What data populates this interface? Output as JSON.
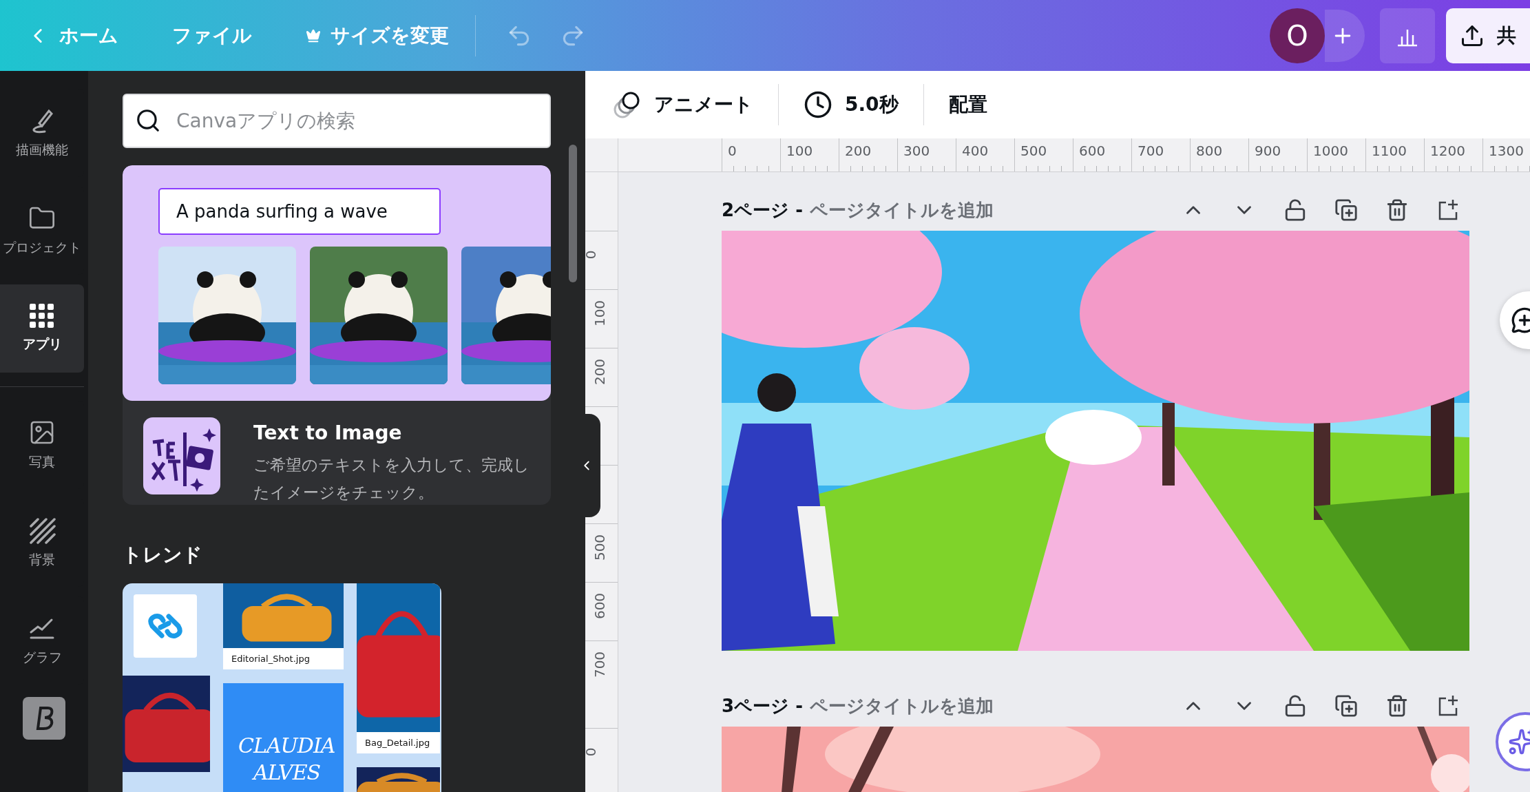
{
  "top_bar": {
    "back_label": "ホーム",
    "menu": [
      {
        "kind": "text",
        "label": "ファイル"
      },
      {
        "kind": "crown",
        "label": "サイズを変更"
      }
    ],
    "history": [
      {
        "kind": "undo",
        "disabled": true
      },
      {
        "kind": "redo",
        "disabled": true
      }
    ],
    "avatar": "O",
    "share_label": "共"
  },
  "rail": [
    {
      "kind": "draw",
      "label": "描画機能",
      "selected": false
    },
    {
      "kind": "folder",
      "label": "プロジェクト",
      "selected": false
    },
    {
      "kind": "apps",
      "label": "アプリ",
      "selected": true
    },
    {
      "kind": "divider"
    },
    {
      "label": "写真",
      "selected": false
    },
    {
      "kind": "stripes",
      "label": "背景",
      "selected": false
    },
    {
      "kind": "graph",
      "label": "グラフ",
      "selected": false
    },
    {
      "kind": "brand"
    }
  ],
  "panel": {
    "search": {
      "placeholder": "Canvaアプリの検索"
    },
    "featured": {
      "prompt": "A panda surfing a wave"
    },
    "app": {
      "title": "Text to Image",
      "description": "ご希望のテキストを入力して、完成したイメージをチェック。"
    },
    "trend_heading": "トレンド",
    "trend": {
      "orange_caption": "Editorial_Shot.jpg",
      "red_caption": "Bag_Detail.jpg",
      "brand_lines": [
        "CLAUDIA",
        "ALVES"
      ]
    }
  },
  "toolbar": [
    {
      "kind": "animate",
      "label": "アニメート"
    },
    {
      "kind": "timer",
      "label": "5.0秒"
    },
    {
      "kind": "text",
      "label": "配置"
    }
  ],
  "ruler": {
    "x_ticks": [
      "0",
      "100",
      "200",
      "300",
      "400",
      "500",
      "600",
      "700",
      "800",
      "900",
      "1000",
      "1100",
      "1200",
      "1300"
    ],
    "y_ticks": [
      "0",
      "100",
      "200"
    ],
    "y_ticks_lower": [
      "500",
      "600",
      "700"
    ],
    "y_ticks_next": [
      "0"
    ]
  },
  "pages": [
    {
      "number": "2ページ -",
      "title_placeholder": "ページタイトルを追加"
    },
    {
      "number": "3ページ -",
      "title_placeholder": "ページタイトルを追加"
    }
  ]
}
